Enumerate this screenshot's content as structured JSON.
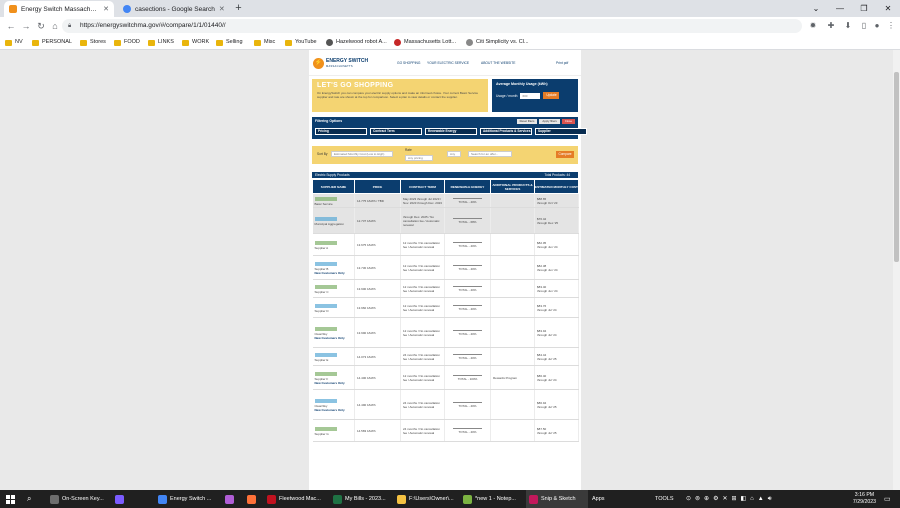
{
  "browser": {
    "tabs": [
      {
        "label": "Energy Switch Massachusetts | Tr",
        "active": true,
        "favicon_color": "#f0901c"
      },
      {
        "label": "casections - Google Search",
        "active": false,
        "favicon_color": "#4285f4"
      }
    ],
    "new_tab": "+",
    "url": "https://energyswitchma.gov/#/compare/1/1/01440//",
    "bookmarks": [
      {
        "label": "NV",
        "type": "folder"
      },
      {
        "label": "PERSONAL",
        "type": "folder"
      },
      {
        "label": "Stores",
        "type": "folder"
      },
      {
        "label": "FOOD",
        "type": "folder"
      },
      {
        "label": "LINKS",
        "type": "folder"
      },
      {
        "label": "WORK",
        "type": "folder"
      },
      {
        "label": "Selling",
        "type": "folder"
      },
      {
        "label": "Misc",
        "type": "folder"
      },
      {
        "label": "YouTube",
        "type": "folder"
      },
      {
        "label": "Hazelwood robot A...",
        "type": "link"
      },
      {
        "label": "Massachusetts Lott...",
        "type": "link"
      },
      {
        "label": "Citi Simplicity vs. Cl...",
        "type": "link"
      }
    ]
  },
  "site": {
    "logo_title": "ENERGY SWITCH",
    "logo_subtitle": "MASSACHUSETTS",
    "nav": [
      "GO SHOPPING",
      "YOUR ELECTRIC SERVICE",
      "ABOUT THE WEBSITE",
      "Print pdf"
    ],
    "hero": {
      "heading": "LET'S GO SHOPPING",
      "text": "On EnergySwitch you can compare your electric supply options and make an informed choice. Your current Basic Service supplier and rate are shown at the top for comparison. Select a plan to view details or contact the supplier."
    },
    "usage": {
      "title": "Average Monthly Usage (kWh)",
      "label": "Usage / month",
      "value": "600",
      "button": "Update"
    },
    "filter": {
      "title": "Filtering Options",
      "buttons": [
        "Reset filters",
        "Apply filters",
        "Close"
      ],
      "categories": [
        "Pricing",
        "Contract Term",
        "Renewable Energy",
        "Additional Products & Services",
        "Supplier"
      ]
    },
    "sort": {
      "label": "Sort By",
      "value": "Estimated Monthly Cost (Low to High)",
      "rate_label": "Rate",
      "rate_value": "Any pricing",
      "mid_value": "Any",
      "search_placeholder": "Search for an offer...",
      "button": "Compare"
    },
    "products_header": {
      "left": "Electric Supply Products",
      "right": "Total Products: 44"
    },
    "table": {
      "headers": [
        "SUPPLIER NAME",
        "PRICE",
        "CONTRACT TERM",
        "RENEWABLE ENERGY",
        "ADDITIONAL PRODUCTS & SERVICES",
        "ESTIMATED MONTHLY COST"
      ],
      "rows": [
        {
          "supplier": "Basic Service",
          "price": "14.775 ¢/kWh / TBD",
          "term": "May 2023 through Jul 2023 / Nov. 2023 through Dec. 2023",
          "renewable": "TOTAL - 40%",
          "extras": "",
          "cost": "$88.65",
          "cost_sub": "through Oct '23",
          "grey": true,
          "new_customers": false
        },
        {
          "supplier": "Municipal Aggregation",
          "price": "12.737 ¢/kWh",
          "term": "through Dec. 2025 / No cancellation fee / Automatic renewal",
          "renewable": "TOTAL - 68%",
          "extras": "",
          "cost": "$76.42",
          "cost_sub": "through Dec '25",
          "grey": true,
          "new_customers": false
        },
        {
          "supplier": "Supplier A",
          "price": "13.675 ¢/kWh",
          "term": "12 months / No cancellation fee / Automatic renewal",
          "renewable": "TOTAL - 40%",
          "extras": "",
          "cost": "$82.05",
          "cost_sub": "through Jun '24",
          "grey": false,
          "new_customers": false
        },
        {
          "supplier": "Supplier B",
          "price": "13.730 ¢/kWh",
          "term": "12 months / No cancellation fee / Automatic renewal",
          "renewable": "TOTAL - 40%",
          "extras": "",
          "cost": "$82.38",
          "cost_sub": "through Jun '24",
          "grey": false,
          "new_customers": true
        },
        {
          "supplier": "Supplier C",
          "price": "13.900 ¢/kWh",
          "term": "12 months / No cancellation fee / Automatic renewal",
          "renewable": "TOTAL - 40%",
          "extras": "",
          "cost": "$83.40",
          "cost_sub": "through Jun '24",
          "grey": false,
          "new_customers": false
        },
        {
          "supplier": "Supplier D",
          "price": "13.960 ¢/kWh",
          "term": "12 months / No cancellation fee / Automatic renewal",
          "renewable": "TOTAL - 40%",
          "extras": "",
          "cost": "$83.76",
          "cost_sub": "through Jul '24",
          "grey": false,
          "new_customers": false
        },
        {
          "supplier": "CleanSky",
          "price": "13.990 ¢/kWh",
          "term": "12 months / No cancellation fee / Automatic renewal",
          "renewable": "TOTAL - 40%",
          "extras": "",
          "cost": "$83.94",
          "cost_sub": "through Jul '24",
          "grey": false,
          "new_customers": true
        },
        {
          "supplier": "Supplier E",
          "price": "14.073 ¢/kWh",
          "term": "24 months / No cancellation fee / Automatic renewal",
          "renewable": "TOTAL - 40%",
          "extras": "",
          "cost": "$84.44",
          "cost_sub": "through Jul '25",
          "grey": false,
          "new_customers": false
        },
        {
          "supplier": "Supplier F",
          "price": "14.400 ¢/kWh",
          "term": "12 months / No cancellation fee / Automatic renewal",
          "renewable": "TOTAL - 100%",
          "extras": "Rewards Program",
          "cost": "$86.40",
          "cost_sub": "through Jul '24",
          "grey": false,
          "new_customers": true
        },
        {
          "supplier": "CleanSky",
          "price": "14.490 ¢/kWh",
          "term": "24 months / No cancellation fee / Automatic renewal",
          "renewable": "TOTAL - 40%",
          "extras": "",
          "cost": "$86.94",
          "cost_sub": "through Jul '25",
          "grey": false,
          "new_customers": true
        },
        {
          "supplier": "Supplier G",
          "price": "14.583 ¢/kWh",
          "term": "24 months / No cancellation fee / Automatic renewal",
          "renewable": "TOTAL - 40%",
          "extras": "",
          "cost": "$87.50",
          "cost_sub": "through Jul '25",
          "grey": false,
          "new_customers": false
        }
      ]
    }
  },
  "taskbar": {
    "items": [
      {
        "label": "On-Screen Key...",
        "color": "#6e6e6e",
        "active": false
      },
      {
        "label": "",
        "color": "#7b5cff",
        "active": false
      },
      {
        "label": "Energy Switch ...",
        "color": "#4285f4",
        "active": false
      },
      {
        "label": "",
        "color": "#b15ed6",
        "active": false
      },
      {
        "label": "",
        "color": "#ff7139",
        "active": false
      },
      {
        "label": "Fleetwood Mac...",
        "color": "#c1121f",
        "active": false
      },
      {
        "label": "My Bills - 2023...",
        "color": "#1f7244",
        "active": false
      },
      {
        "label": "F:\\Users\\Owner\\...",
        "color": "#f5c242",
        "active": false
      },
      {
        "label": "*new 1 - Notep...",
        "color": "#7cb342",
        "active": false
      },
      {
        "label": "Snip & Sketch",
        "color": "#c2185b",
        "active": true
      }
    ],
    "apps_label": "Apps",
    "tools_label": "TOOLS",
    "time": "3:16 PM",
    "date": "7/29/2023"
  }
}
